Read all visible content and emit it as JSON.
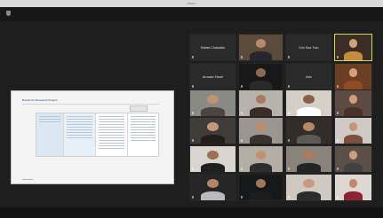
{
  "window": {
    "title": "Zoom"
  },
  "header": {
    "info_label": ""
  },
  "shared_doc": {
    "title": "Rubric for Research Project",
    "table_columns": 4
  },
  "participants": [
    {
      "name": "Rafael Chatzakis",
      "kind": "name"
    },
    {
      "name": "",
      "kind": "video",
      "bg": "#5a4b3c",
      "skin": "#b8896b",
      "shirt": "#25272c"
    },
    {
      "name": "Kim Hoa Tran",
      "kind": "name"
    },
    {
      "name": "",
      "kind": "video",
      "bg": "#3c2e24",
      "skin": "#d0a27d",
      "shirt": "#c58b3f",
      "active": true
    },
    {
      "name": "Armaan Tiwari",
      "kind": "name"
    },
    {
      "name": "",
      "kind": "video",
      "bg": "#181818",
      "skin": "#8a6a55",
      "shirt": "#2a2a2a"
    },
    {
      "name": "Aviv",
      "kind": "name"
    },
    {
      "name": "",
      "kind": "video",
      "bg": "#6a3f24",
      "skin": "#d7a07a",
      "shirt": "#8f4b21"
    },
    {
      "name": "",
      "kind": "video",
      "bg": "#8a8a84",
      "skin": "#c2916e",
      "shirt": "#4b4540"
    },
    {
      "name": "",
      "kind": "video",
      "bg": "#b7b2ab",
      "skin": "#a77a5f",
      "shirt": "#3a2d25"
    },
    {
      "name": "",
      "kind": "video",
      "bg": "#d4d0c8",
      "skin": "#8b6048",
      "shirt": "#ffffff"
    },
    {
      "name": "",
      "kind": "video",
      "bg": "#5b4b42",
      "skin": "#d29d7a",
      "shirt": "#4a3028"
    },
    {
      "name": "",
      "kind": "video",
      "bg": "#3f3d39",
      "skin": "#c6967b",
      "shirt": "#201f1d"
    },
    {
      "name": "",
      "kind": "video",
      "bg": "#9a968f",
      "skin": "#bb8b6c",
      "shirt": "#38332f"
    },
    {
      "name": "",
      "kind": "video",
      "bg": "#302d2a",
      "skin": "#b88766",
      "shirt": "#5d5a55"
    },
    {
      "name": "",
      "kind": "video",
      "bg": "#cfcac3",
      "skin": "#c49578",
      "shirt": "#7c4f40"
    },
    {
      "name": "",
      "kind": "video",
      "bg": "#d8d5cf",
      "skin": "#9f6f55",
      "shirt": "#202020"
    },
    {
      "name": "",
      "kind": "video",
      "bg": "#b4aea5",
      "skin": "#c18f71",
      "shirt": "#2e2e31"
    },
    {
      "name": "",
      "kind": "video",
      "bg": "#8a837b",
      "skin": "#ad7b5c",
      "shirt": "#242424"
    },
    {
      "name": "",
      "kind": "video",
      "bg": "#5a5047",
      "skin": "#cf9e7c",
      "shirt": "#414141"
    },
    {
      "name": "",
      "kind": "video",
      "bg": "#262626",
      "skin": "#b08568",
      "shirt": "#bbbbbb"
    },
    {
      "name": "",
      "kind": "video",
      "bg": "#17181a",
      "skin": "#9e775f",
      "shirt": "#1d1d1d"
    },
    {
      "name": "",
      "kind": "video",
      "bg": "#cfc9c2",
      "skin": "#c99a7f",
      "shirt": "#2c2c2c"
    },
    {
      "name": "",
      "kind": "video",
      "bg": "#ddd9d2",
      "skin": "#bd8a6c",
      "shirt": "#8d2434"
    }
  ],
  "colors": {
    "background": "#1e1e1e",
    "active_speaker": "#c9d95a"
  }
}
